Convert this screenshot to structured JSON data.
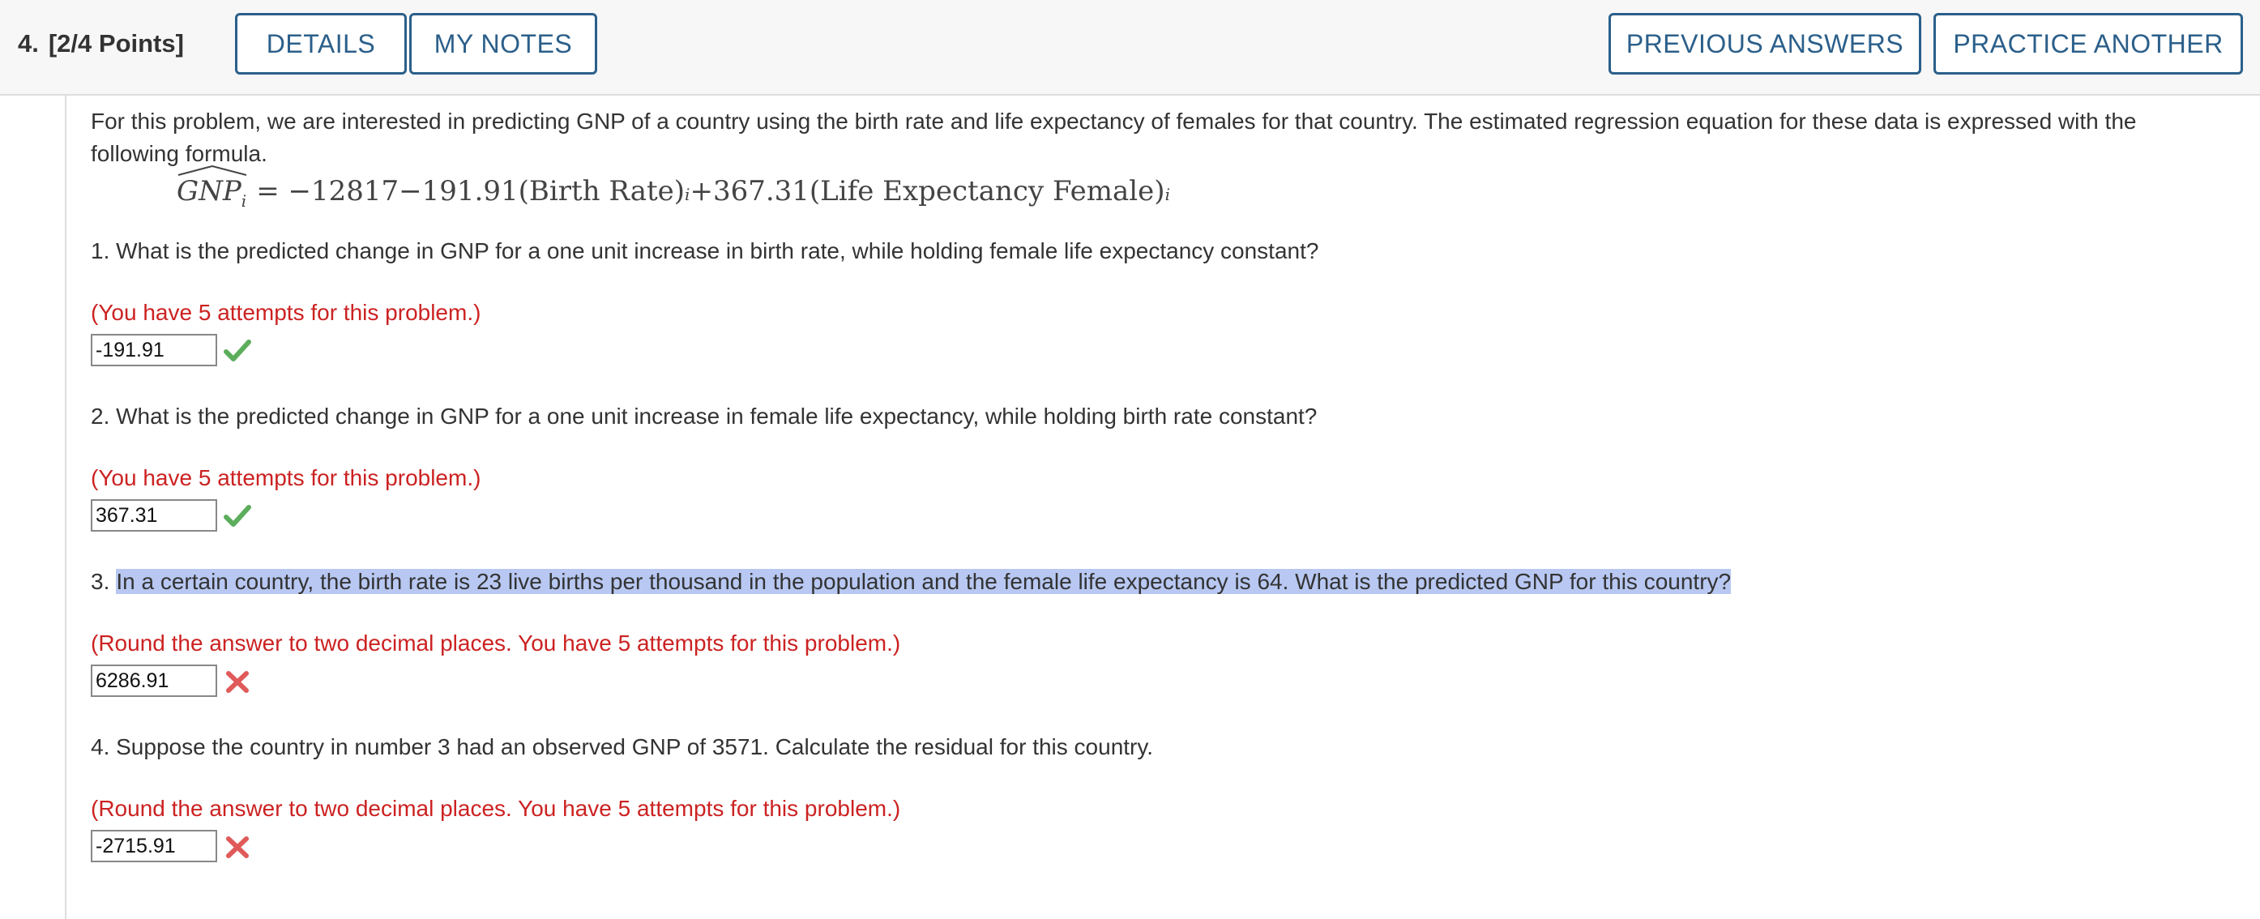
{
  "header": {
    "question_number": "4.",
    "points": "[2/4 Points]",
    "details_label": "DETAILS",
    "notes_label": "MY NOTES",
    "previous_label": "PREVIOUS ANSWERS",
    "practice_label": "PRACTICE ANOTHER"
  },
  "intro": "For this problem, we are interested in predicting GNP of a country using the birth rate and life expectancy of females for that country. The estimated regression equation for these data is expressed with the following formula.",
  "formula": {
    "lhs": "GNP",
    "lhs_sub": "i",
    "rhs_a": "= −12817−191.91(Birth Rate)",
    "sub_a": "i",
    "rhs_b": "+367.31(Life Expectancy Female)",
    "sub_b": "i"
  },
  "questions": [
    {
      "text": "1. What is the predicted change in GNP for a one unit increase in birth rate, while holding female life expectancy constant?",
      "attempts": "(You have 5 attempts for this problem.)",
      "answer": "-191.91",
      "status": "correct"
    },
    {
      "text": "2. What is the predicted change in GNP for a one unit increase in female life expectancy, while holding birth rate constant?",
      "attempts": "(You have 5 attempts for this problem.)",
      "answer": "367.31",
      "status": "correct"
    },
    {
      "number": "3.",
      "text": "In a certain country, the birth rate is 23 live births per thousand in the population and the female life expectancy is 64. What is the predicted GNP for this country?",
      "attempts": "(Round the answer to two decimal places. You have 5 attempts for this problem.)",
      "answer": "6286.91",
      "status": "incorrect"
    },
    {
      "text": "4. Suppose the country in number 3 had an observed GNP of 3571. Calculate the residual for this country.",
      "attempts": "(Round the answer to two decimal places. You have 5 attempts for this problem.)",
      "answer": "-2715.91",
      "status": "incorrect"
    }
  ],
  "icons": {
    "correct": "checkmark-icon",
    "incorrect": "x-mark-icon"
  },
  "colors": {
    "button_text": "#2b5f8a",
    "attempt_text": "#cc2222",
    "correct": "#5cad5c",
    "incorrect": "#e05a5a",
    "highlight": "#b8c8f2"
  }
}
